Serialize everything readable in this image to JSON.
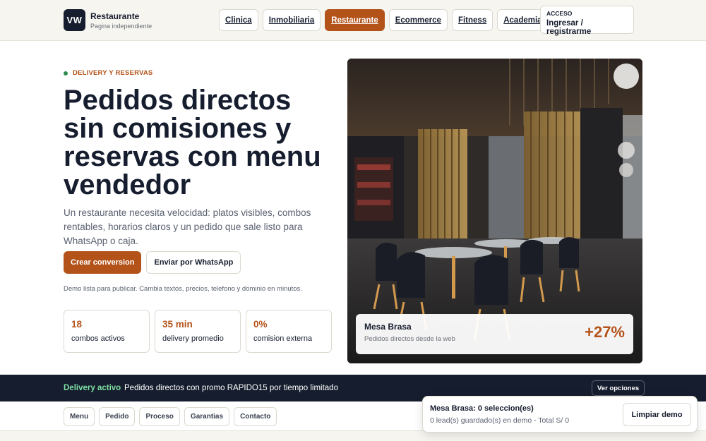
{
  "brand": {
    "logo_text": "VW",
    "name": "Restaurante",
    "subtitle": "Pagina independiente"
  },
  "nav": {
    "items": [
      "Clinica",
      "Inmobiliaria",
      "Restaurante",
      "Ecommerce",
      "Fitness",
      "Academia"
    ],
    "active": "Restaurante"
  },
  "access": {
    "label": "ACCESO",
    "link": "Ingresar / registrarme"
  },
  "hero": {
    "eyebrow": "DELIVERY Y RESERVAS",
    "headline": "Pedidos directos sin comisiones y reservas con menu vendedor",
    "description": "Un restaurante necesita velocidad: platos visibles, combos rentables, horarios claros y un pedido que sale listo para WhatsApp o caja.",
    "primary_cta": "Crear conversion",
    "secondary_cta": "Enviar por WhatsApp",
    "note": "Demo lista para publicar. Cambia textos, precios, telefono y dominio en minutos.",
    "stats": [
      {
        "value": "18",
        "label": "combos activos"
      },
      {
        "value": "35 min",
        "label": "delivery promedio"
      },
      {
        "value": "0%",
        "label": "comision externa"
      }
    ],
    "image_card": {
      "title": "Mesa Brasa",
      "subtitle": "Pedidos directos desde la web",
      "metric": "+27%"
    }
  },
  "promo": {
    "highlight": "Delivery activo",
    "text": "Pedidos directos con promo RAPIDO15 por tiempo limitado",
    "button": "Ver opciones"
  },
  "section_nav": [
    "Menu",
    "Pedido",
    "Proceso",
    "Garantias",
    "Contacto"
  ],
  "cart": {
    "title": "Mesa Brasa: 0 seleccion(es)",
    "summary": "0 lead(s) guardado(s) en demo - Total S/ 0",
    "clear_button": "Limpiar demo"
  },
  "colors": {
    "accent": "#b3531a",
    "dark": "#161d2e",
    "success": "#2d8a4e",
    "promo_highlight": "#7ee0a3"
  }
}
